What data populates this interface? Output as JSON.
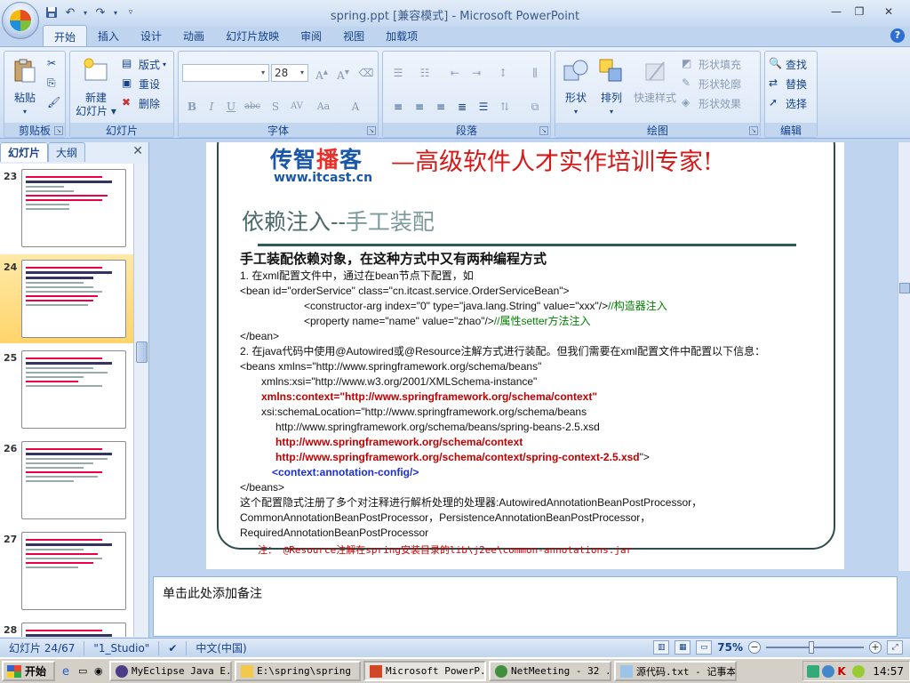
{
  "window": {
    "title": "spring.ppt [兼容模式] - Microsoft PowerPoint"
  },
  "ribbon_tabs": [
    "开始",
    "插入",
    "设计",
    "动画",
    "幻灯片放映",
    "审阅",
    "视图",
    "加载项"
  ],
  "ribbon": {
    "clipboard": {
      "label": "剪贴板",
      "paste": "粘贴"
    },
    "slides": {
      "label": "幻灯片",
      "new_slide_1": "新建",
      "new_slide_2": "幻灯片",
      "layout": "版式",
      "reset": "重设",
      "delete": "删除"
    },
    "font": {
      "label": "字体",
      "font_name": "",
      "font_size": "28"
    },
    "paragraph": {
      "label": "段落"
    },
    "drawing": {
      "label": "绘图",
      "shapes": "形状",
      "arrange": "排列",
      "quick_styles": "快速样式",
      "shape_fill": "形状填充",
      "shape_outline": "形状轮廓",
      "shape_effects": "形状效果"
    },
    "editing": {
      "label": "编辑",
      "find": "查找",
      "replace": "替换",
      "select": "选择"
    }
  },
  "panel": {
    "tab_slides": "幻灯片",
    "tab_outline": "大纲",
    "thumbnails": [
      {
        "num": "23",
        "selected": false
      },
      {
        "num": "24",
        "selected": true
      },
      {
        "num": "25",
        "selected": false
      },
      {
        "num": "26",
        "selected": false
      },
      {
        "num": "27",
        "selected": false
      },
      {
        "num": "28",
        "selected": false
      }
    ]
  },
  "slide": {
    "brand_a": "传智",
    "brand_b": "播",
    "brand_c": "客",
    "brand_url": "www.itcast.cn",
    "slogan": "—高级软件人才实作培训专家!",
    "title_a": "依赖注入--",
    "title_b": "手工装配",
    "heading": "手工装配依赖对象，在这种方式中又有两种编程方式",
    "line1": "1. 在xml配置文件中，通过在bean节点下配置，如",
    "line2": "<bean id=\"orderService\" class=\"cn.itcast.service.OrderServiceBean\">",
    "line3": "<constructor-arg index=\"0\" type=\"java.lang.String\" value=\"xxx\"/>",
    "line3_comment": "//构造器注入",
    "line4": "<property name=\"name\" value=\"zhao\"/>",
    "line4_comment": "//属性setter方法注入",
    "line5": "</bean>",
    "line6": "2. 在java代码中使用@Autowired或@Resource注解方式进行装配。但我们需要在xml配置文件中配置以下信息：",
    "line7": "<beans xmlns=\"http://www.springframework.org/schema/beans\"",
    "line8": "xmlns:xsi=\"http://www.w3.org/2001/XMLSchema-instance\"",
    "line9": "xmlns:context=\"http://www.springframework.org/schema/context\"",
    "line10": "xsi:schemaLocation=\"http://www.springframework.org/schema/beans",
    "line11": "http://www.springframework.org/schema/beans/spring-beans-2.5.xsd",
    "line12": "http://www.springframework.org/schema/context",
    "line13": "http://www.springframework.org/schema/context/spring-context-2.5.xsd",
    "line13_tail": "\">",
    "line14": "<context:annotation-config/>",
    "line15": "</beans>",
    "line16": "这个配置隐式注册了多个对注释进行解析处理的处理器:AutowiredAnnotationBeanPostProcessor，",
    "line17": "CommonAnnotationBeanPostProcessor，PersistenceAnnotationBeanPostProcessor，",
    "line18": "RequiredAnnotationBeanPostProcessor",
    "note": "注：  @Resource注解在spring安装目录的lib\\j2ee\\common-annotations.jar"
  },
  "notes_placeholder": "单击此处添加备注",
  "status": {
    "slide_pos": "幻灯片 24/67",
    "theme": "\"1_Studio\"",
    "language": "中文(中国)",
    "zoom": "75%"
  },
  "taskbar": {
    "start": "开始",
    "tasks": [
      {
        "label": "MyEclipse Java E...",
        "active": false
      },
      {
        "label": "E:\\spring\\spring",
        "active": false
      },
      {
        "label": "Microsoft PowerP...",
        "active": true
      },
      {
        "label": "NetMeeting - 32 ...",
        "active": false
      },
      {
        "label": "源代码.txt - 记事本",
        "active": false
      }
    ],
    "clock": "14:57"
  },
  "colors": {
    "ribbon_bg": "#dbe7f7",
    "accent_red": "#c00000",
    "accent_blue": "#1a57a8"
  }
}
